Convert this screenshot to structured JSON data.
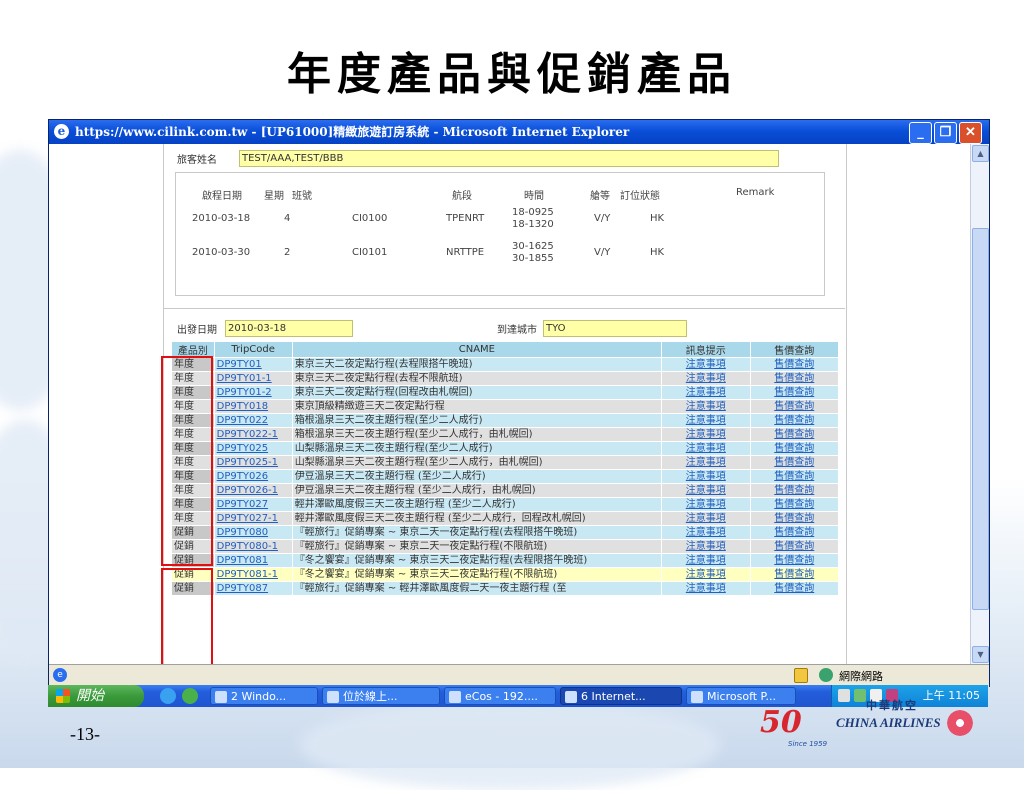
{
  "slide": {
    "title": "年度產品與促銷產品",
    "page_number": "-13-"
  },
  "window": {
    "title": "https://www.cilink.com.tw - [UP61000]精緻旅遊訂房系統 - Microsoft Internet Explorer",
    "min_glyph": "_",
    "max_glyph": "❐",
    "close_glyph": "✕"
  },
  "form": {
    "pax_label": "旅客姓名",
    "pax_value": "TEST/AAA,TEST/BBB",
    "segments_headers": [
      "啟程日期",
      "星期",
      "班號",
      "航段",
      "時間",
      "艙等",
      "訂位狀態",
      "Remark"
    ],
    "segments": [
      {
        "date": "2010-03-18",
        "dow": "4",
        "flight": "CI0100",
        "route": "TPENRT",
        "time1": "18-0925",
        "time2": "18-1320",
        "class": "V/Y",
        "status": "HK"
      },
      {
        "date": "2010-03-30",
        "dow": "2",
        "flight": "CI0101",
        "route": "NRTTPE",
        "time1": "30-1625",
        "time2": "30-1855",
        "class": "V/Y",
        "status": "HK"
      }
    ],
    "dep_label": "出發日期",
    "dep_value": "2010-03-18",
    "arr_label": "到達城市",
    "arr_value": "TYO"
  },
  "grid": {
    "headers": [
      "產品別",
      "TripCode",
      "CNAME",
      "訊息提示",
      "售價查詢"
    ],
    "rows": [
      {
        "cat": "年度",
        "code": "DP9TY01",
        "name": "東京三天二夜定點行程(去程限搭午晚班)",
        "info": "注意事項",
        "price": "售價查詢"
      },
      {
        "cat": "年度",
        "code": "DP9TY01-1",
        "name": "東京三天二夜定點行程(去程不限航班)",
        "info": "注意事項",
        "price": "售價查詢"
      },
      {
        "cat": "年度",
        "code": "DP9TY01-2",
        "name": "東京三天二夜定點行程(回程改由札幌回)",
        "info": "注意事項",
        "price": "售價查詢"
      },
      {
        "cat": "年度",
        "code": "DP9TY018",
        "name": "東京頂級精緻遊三天二夜定點行程",
        "info": "注意事項",
        "price": "售價查詢"
      },
      {
        "cat": "年度",
        "code": "DP9TY022",
        "name": "箱根溫泉三天二夜主題行程(至少二人成行)",
        "info": "注意事項",
        "price": "售價查詢"
      },
      {
        "cat": "年度",
        "code": "DP9TY022-1",
        "name": "箱根溫泉三天二夜主題行程(至少二人成行，由札幌回)",
        "info": "注意事項",
        "price": "售價查詢"
      },
      {
        "cat": "年度",
        "code": "DP9TY025",
        "name": "山梨縣溫泉三天二夜主題行程(至少二人成行)",
        "info": "注意事項",
        "price": "售價查詢"
      },
      {
        "cat": "年度",
        "code": "DP9TY025-1",
        "name": "山梨縣溫泉三天二夜主題行程(至少二人成行，由札幌回)",
        "info": "注意事項",
        "price": "售價查詢"
      },
      {
        "cat": "年度",
        "code": "DP9TY026",
        "name": "伊豆溫泉三天二夜主題行程 (至少二人成行)",
        "info": "注意事項",
        "price": "售價查詢"
      },
      {
        "cat": "年度",
        "code": "DP9TY026-1",
        "name": "伊豆溫泉三天二夜主題行程 (至少二人成行，由札幌回)",
        "info": "注意事項",
        "price": "售價查詢"
      },
      {
        "cat": "年度",
        "code": "DP9TY027",
        "name": "輕井澤歐風度假三天二夜主題行程 (至少二人成行)",
        "info": "注意事項",
        "price": "售價查詢"
      },
      {
        "cat": "年度",
        "code": "DP9TY027-1",
        "name": "輕井澤歐風度假三天二夜主題行程 (至少二人成行，回程改札幌回)",
        "info": "注意事項",
        "price": "售價查詢"
      },
      {
        "cat": "促銷",
        "code": "DP9TY080",
        "name": "『輕旅行』促銷專案 ~ 東京二天一夜定點行程(去程限搭午晚班)",
        "info": "注意事項",
        "price": "售價查詢"
      },
      {
        "cat": "促銷",
        "code": "DP9TY080-1",
        "name": "『輕旅行』促銷專案 ~ 東京二天一夜定點行程(不限航班)",
        "info": "注意事項",
        "price": "售價查詢"
      },
      {
        "cat": "促銷",
        "code": "DP9TY081",
        "name": "『冬之饗宴』促銷專案 ~ 東京三天二夜定點行程(去程限搭午晚班)",
        "info": "注意事項",
        "price": "售價查詢"
      },
      {
        "cat": "促銷",
        "code": "DP9TY081-1",
        "name": "『冬之饗宴』促銷專案 ~ 東京三天二夜定點行程(不限航班)",
        "info": "注意事項",
        "price": "售價查詢"
      },
      {
        "cat": "促銷",
        "code": "DP9TY087",
        "name": "『輕旅行』促銷專案 ~ 輕井澤歐風度假二天一夜主題行程 (至",
        "info": "注意事項",
        "price": "售價查詢"
      }
    ]
  },
  "statusbar": {
    "zone": "網際網路"
  },
  "taskbar": {
    "start": "開始",
    "items": [
      "2 Windo...",
      "位於線上...",
      "eCos - 192....",
      "6 Internet...",
      "Microsoft P..."
    ],
    "clock": "上午 11:05"
  },
  "logo": {
    "fifty": "50",
    "since": "Since 1959",
    "cn": "中華航空",
    "en": "CHINA AIRLINES"
  }
}
